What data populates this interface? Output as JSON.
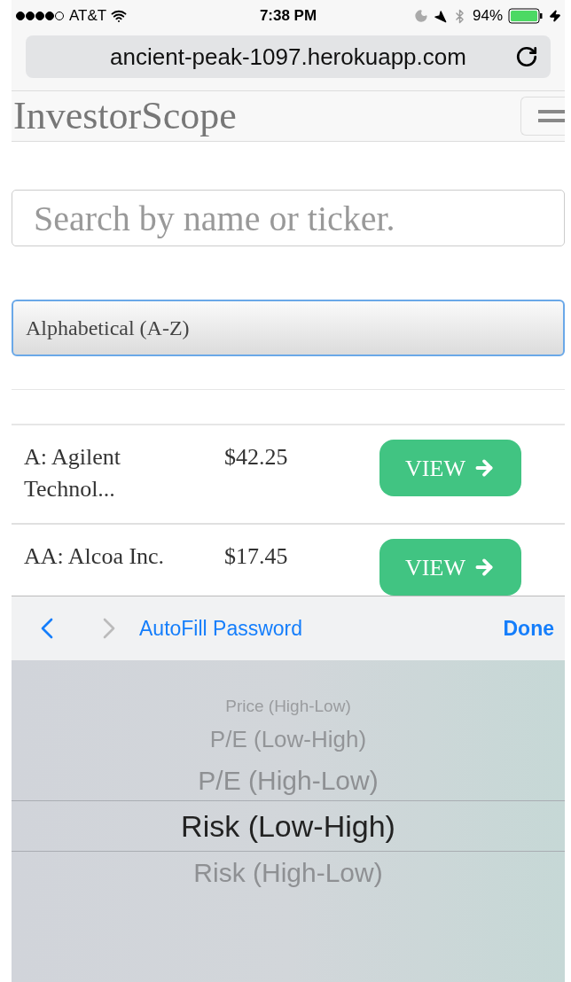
{
  "status_bar": {
    "carrier": "AT&T",
    "time": "7:38 PM",
    "battery": "94%"
  },
  "address_bar": {
    "url": "ancient-peak-1097.herokuapp.com"
  },
  "navbar": {
    "brand": "InvestorScope"
  },
  "search": {
    "placeholder": "Search by name or ticker."
  },
  "sort_select": {
    "value": "Alphabetical (A-Z)"
  },
  "stocks": [
    {
      "name": "A: Agilent Technol...",
      "price": "$42.25",
      "button": "VIEW"
    },
    {
      "name": "AA: Alcoa Inc.",
      "price": "$17.45",
      "button": "VIEW"
    }
  ],
  "keyboard_toolbar": {
    "autofill": "AutoFill Password",
    "done": "Done"
  },
  "picker": [
    {
      "label": "Price (High-Low)",
      "selected": false
    },
    {
      "label": "P/E (Low-High)",
      "selected": false
    },
    {
      "label": "P/E (High-Low)",
      "selected": false
    },
    {
      "label": "Risk (Low-High)",
      "selected": true
    },
    {
      "label": "Risk (High-Low)",
      "selected": false
    }
  ]
}
